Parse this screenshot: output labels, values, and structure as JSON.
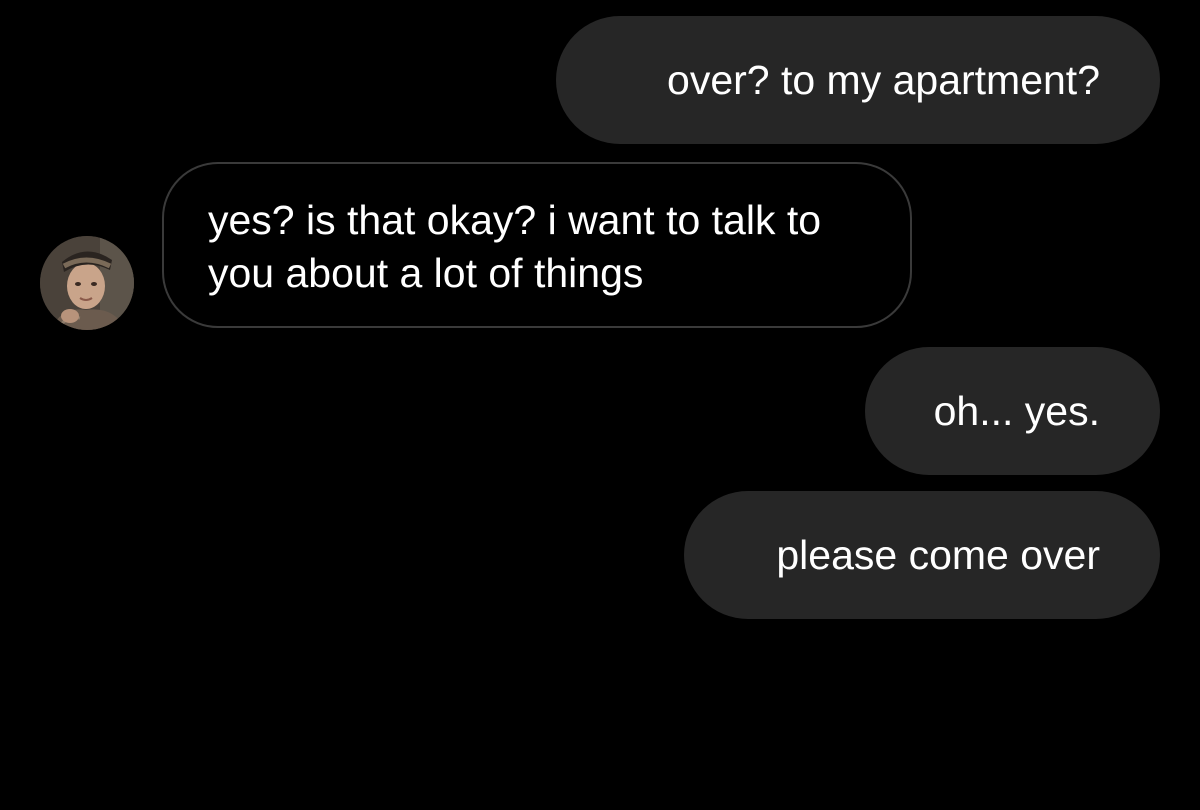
{
  "conversation": {
    "messages": [
      {
        "sender": "me",
        "text": "over? to my apartment?"
      },
      {
        "sender": "them",
        "text": "yes? is that okay? i want to talk to you about a lot of things"
      },
      {
        "sender": "me",
        "text": "oh... yes."
      },
      {
        "sender": "me",
        "text": "please come over"
      }
    ]
  },
  "avatar": {
    "icon": "contact-photo"
  },
  "colors": {
    "background": "#000000",
    "sent_bubble": "#262626",
    "received_border": "#3a3a3a",
    "text": "#ffffff"
  }
}
